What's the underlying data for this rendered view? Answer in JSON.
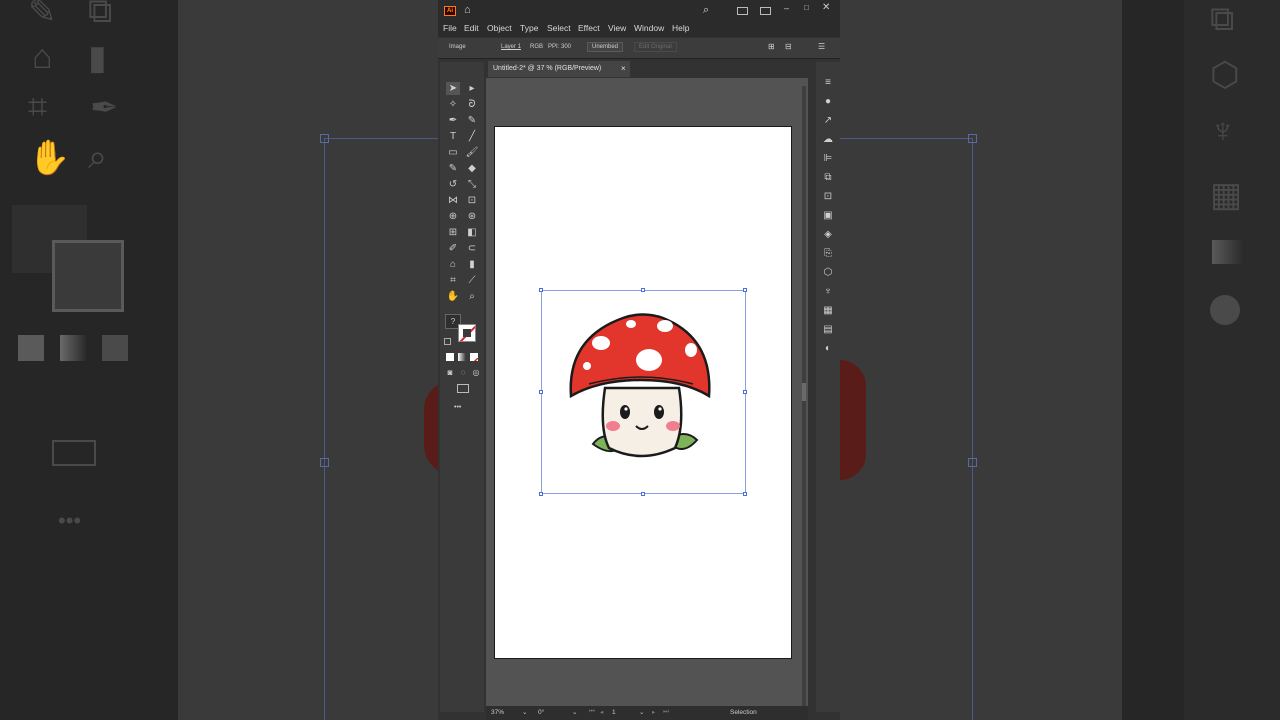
{
  "app": {
    "logo": "Ai",
    "menus": [
      "File",
      "Edit",
      "Object",
      "Type",
      "Select",
      "Effect",
      "View",
      "Window",
      "Help"
    ]
  },
  "control_bar": {
    "selection_type": "Image",
    "layer": "Layer 1",
    "color_mode": "RGB",
    "ppi": "PPI: 300",
    "unembed_label": "Unembed",
    "edit_original_label": "Edit Original"
  },
  "document": {
    "tab_title": "Untitled-2* @ 37 % (RGB/Preview)",
    "close_glyph": "×"
  },
  "status": {
    "zoom": "37%",
    "rotation": "0°",
    "artboard_number": "1",
    "tool_name": "Selection"
  },
  "colors": {
    "accent": "#4a6fd8",
    "mushroom_cap": "#e2352c",
    "artboard": "#ffffff"
  },
  "toolbar": {
    "more_tools_glyph": "•••",
    "unknown_fill_glyph": "?"
  }
}
